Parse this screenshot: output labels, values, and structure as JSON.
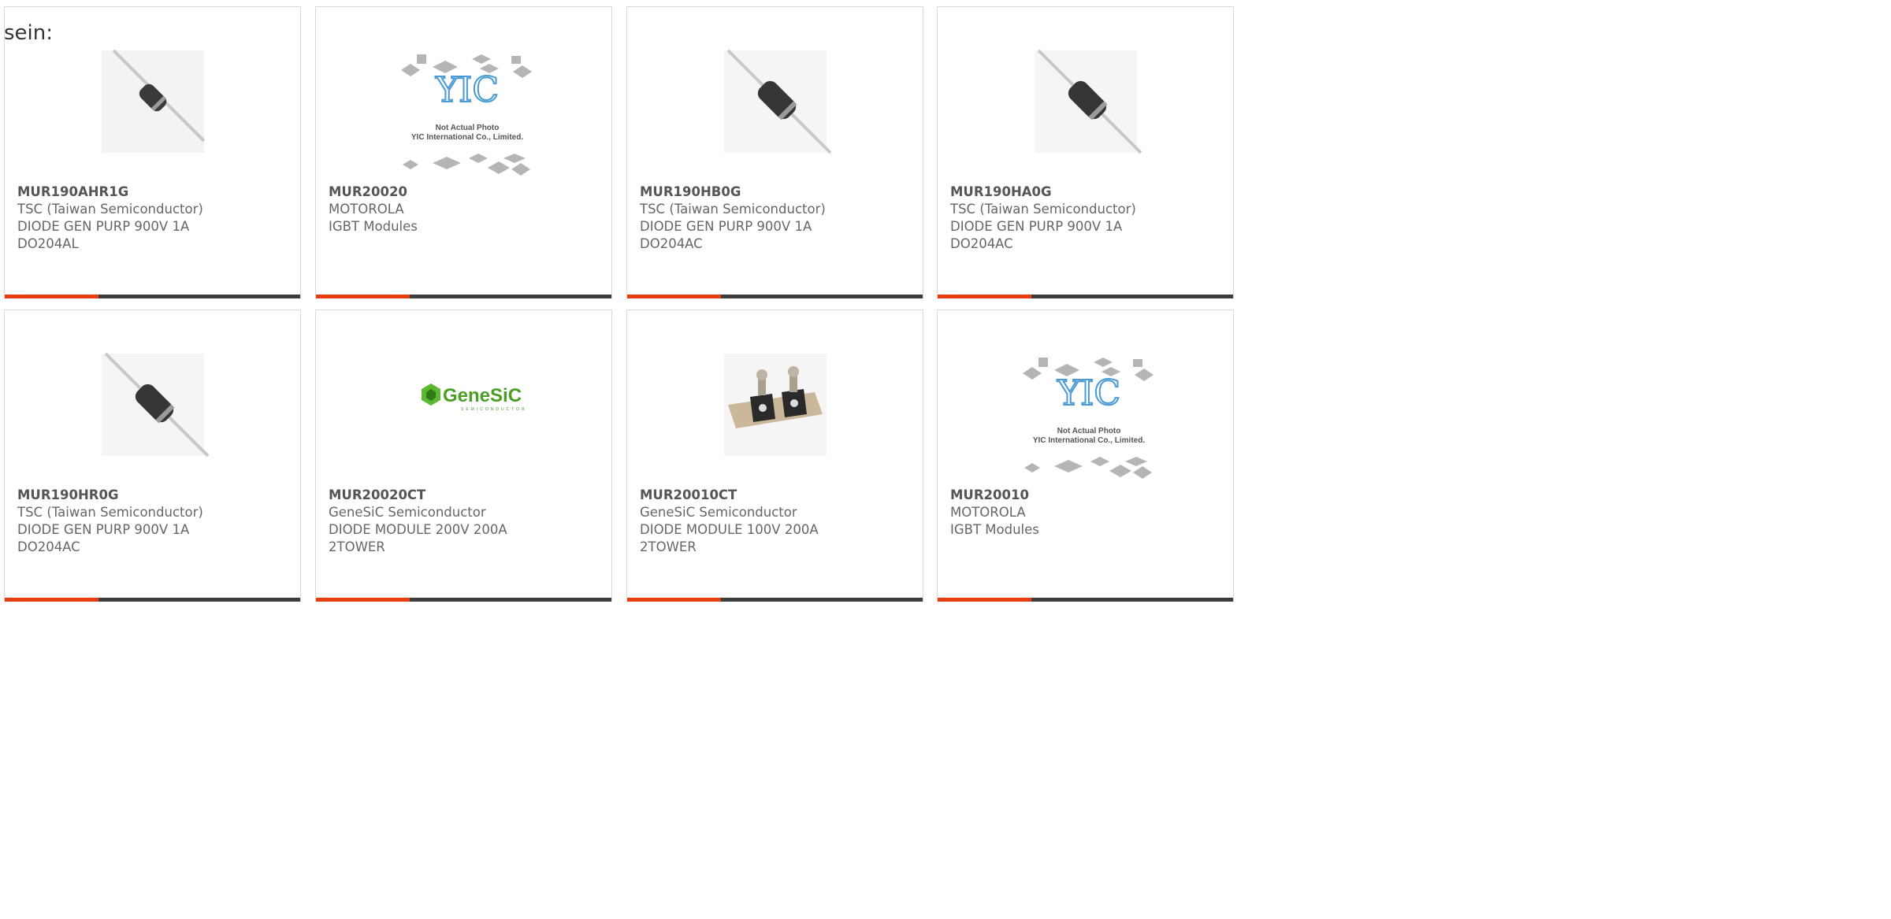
{
  "intro": "sein:",
  "accent_color": "#e63e0e",
  "bar_color": "#3d3d3d",
  "products": [
    {
      "part": "MUR190AHR1G",
      "manufacturer": "TSC (Taiwan Semiconductor)",
      "description": "DIODE GEN PURP 900V 1A",
      "package": "DO204AL",
      "image": "axial-diode-small"
    },
    {
      "part": "MUR20020",
      "manufacturer": "MOTOROLA",
      "description": "IGBT Modules",
      "package": "",
      "image": "yic-placeholder",
      "placeholder_line1": "Not Actual Photo",
      "placeholder_line2": "YIC International Co., Limited."
    },
    {
      "part": "MUR190HB0G",
      "manufacturer": "TSC (Taiwan Semiconductor)",
      "description": "DIODE GEN PURP 900V 1A",
      "package": "DO204AC",
      "image": "axial-diode"
    },
    {
      "part": "MUR190HA0G",
      "manufacturer": "TSC (Taiwan Semiconductor)",
      "description": "DIODE GEN PURP 900V 1A",
      "package": "DO204AC",
      "image": "axial-diode"
    },
    {
      "part": "MUR190HR0G",
      "manufacturer": "TSC (Taiwan Semiconductor)",
      "description": "DIODE GEN PURP 900V 1A",
      "package": "DO204AC",
      "image": "axial-diode"
    },
    {
      "part": "MUR20020CT",
      "manufacturer": "GeneSiC Semiconductor",
      "description": "DIODE MODULE 200V 200A",
      "package": "2TOWER",
      "image": "genesic-logo",
      "logo_text": "GeneSiC",
      "logo_sub": "SEMICONDUCTOR"
    },
    {
      "part": "MUR20010CT",
      "manufacturer": "GeneSiC Semiconductor",
      "description": "DIODE MODULE 100V 200A",
      "package": "2TOWER",
      "image": "2tower-module"
    },
    {
      "part": "MUR20010",
      "manufacturer": "MOTOROLA",
      "description": "IGBT Modules",
      "package": "",
      "image": "yic-placeholder",
      "placeholder_line1": "Not Actual Photo",
      "placeholder_line2": "YIC International Co., Limited."
    }
  ]
}
